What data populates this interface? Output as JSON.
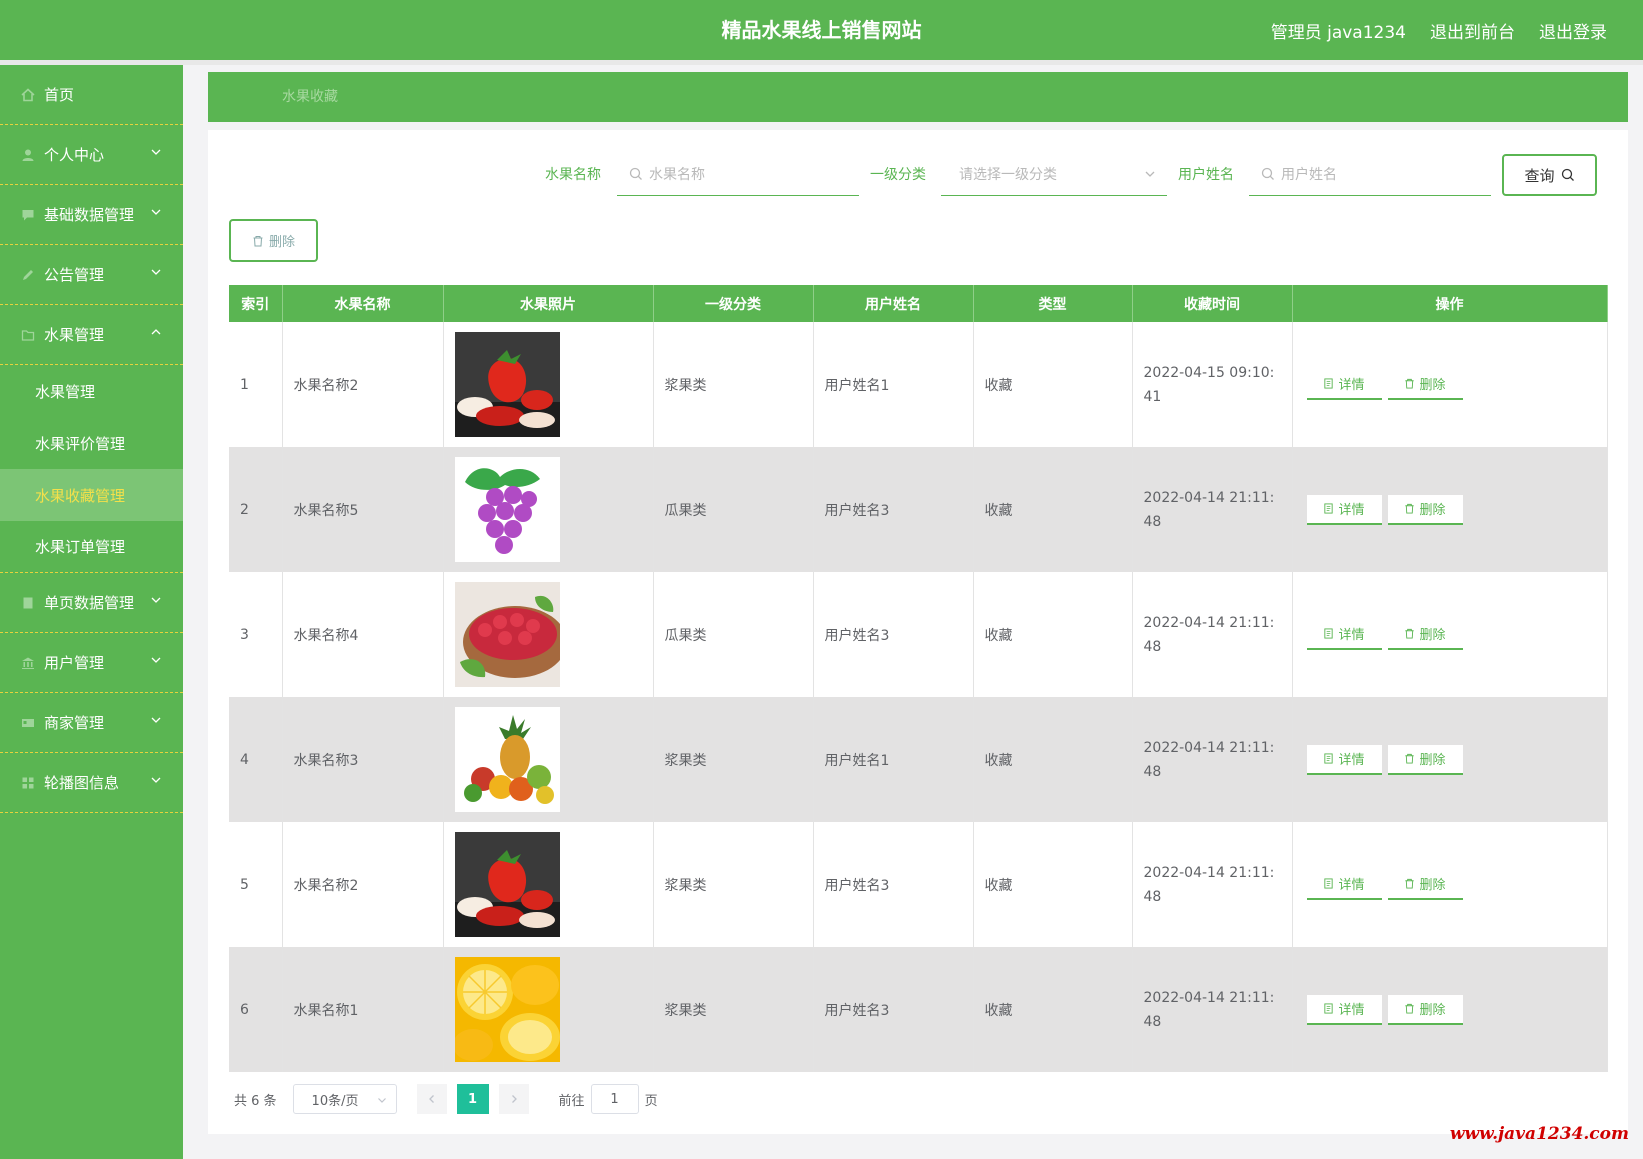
{
  "header": {
    "title": "精品水果线上销售网站",
    "user": "管理员 java1234",
    "to_front": "退出到前台",
    "logout": "退出登录"
  },
  "sidebar": {
    "items": [
      {
        "label": "首页",
        "icon": "home-icon",
        "has_children": false
      },
      {
        "label": "个人中心",
        "icon": "user-icon",
        "has_children": true,
        "expanded": false
      },
      {
        "label": "基础数据管理",
        "icon": "chat-icon",
        "has_children": true,
        "expanded": false
      },
      {
        "label": "公告管理",
        "icon": "edit-icon",
        "has_children": true,
        "expanded": false
      },
      {
        "label": "水果管理",
        "icon": "folder-icon",
        "has_children": true,
        "expanded": true,
        "children": [
          {
            "label": "水果管理",
            "active": false
          },
          {
            "label": "水果评价管理",
            "active": false
          },
          {
            "label": "水果收藏管理",
            "active": true
          },
          {
            "label": "水果订单管理",
            "active": false
          }
        ]
      },
      {
        "label": "单页数据管理",
        "icon": "document-icon",
        "has_children": true,
        "expanded": false
      },
      {
        "label": "用户管理",
        "icon": "bank-icon",
        "has_children": true,
        "expanded": false
      },
      {
        "label": "商家管理",
        "icon": "id-card-icon",
        "has_children": true,
        "expanded": false
      },
      {
        "label": "轮播图信息",
        "icon": "grid-icon",
        "has_children": true,
        "expanded": false
      }
    ]
  },
  "breadcrumb": "水果收藏",
  "search": {
    "fruit_name_label": "水果名称",
    "fruit_name_placeholder": "水果名称",
    "category_label": "一级分类",
    "category_placeholder": "请选择一级分类",
    "username_label": "用户姓名",
    "username_placeholder": "用户姓名",
    "query_label": "查询"
  },
  "toolbar": {
    "delete_label": "删除"
  },
  "table": {
    "headers": [
      "索引",
      "水果名称",
      "水果照片",
      "一级分类",
      "用户姓名",
      "类型",
      "收藏时间",
      "操作"
    ],
    "rows": [
      {
        "index": "1",
        "name": "水果名称2",
        "photo": "strawberry",
        "category": "浆果类",
        "user": "用户姓名1",
        "type": "收藏",
        "time": "2022-04-15 09:10:41"
      },
      {
        "index": "2",
        "name": "水果名称5",
        "photo": "grape",
        "category": "瓜果类",
        "user": "用户姓名3",
        "type": "收藏",
        "time": "2022-04-14 21:11:48"
      },
      {
        "index": "3",
        "name": "水果名称4",
        "photo": "raspberry",
        "category": "瓜果类",
        "user": "用户姓名3",
        "type": "收藏",
        "time": "2022-04-14 21:11:48"
      },
      {
        "index": "4",
        "name": "水果名称3",
        "photo": "mixed-fruit",
        "category": "浆果类",
        "user": "用户姓名1",
        "type": "收藏",
        "time": "2022-04-14 21:11:48"
      },
      {
        "index": "5",
        "name": "水果名称2",
        "photo": "strawberry",
        "category": "浆果类",
        "user": "用户姓名3",
        "type": "收藏",
        "time": "2022-04-14 21:11:48"
      },
      {
        "index": "6",
        "name": "水果名称1",
        "photo": "lemon",
        "category": "浆果类",
        "user": "用户姓名3",
        "type": "收藏",
        "time": "2022-04-14 21:11:48"
      }
    ],
    "detail_label": "详情",
    "delete_label": "删除"
  },
  "pagination": {
    "total": "共 6 条",
    "page_size": "10条/页",
    "current": "1",
    "goto_prefix": "前往",
    "goto_value": "1",
    "goto_suffix": "页"
  },
  "watermark": "www.java1234.com",
  "colors": {
    "primary": "#5ab552",
    "active_text": "#f3e04a",
    "pager_active": "#1fbf9a",
    "divider": "#e6d23c"
  }
}
